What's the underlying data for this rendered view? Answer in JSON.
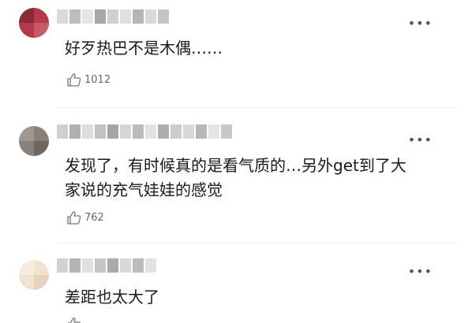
{
  "comments": [
    {
      "text": "好歹热巴不是木偶……",
      "likes": "1012",
      "more_label": "•••"
    },
    {
      "text": "发现了，有时候真的是看气质的…另外get到了大家说的充气娃娃的感觉",
      "likes": "762",
      "more_label": "•••"
    },
    {
      "text": "差距也太大了",
      "more_label": "•••"
    }
  ],
  "icons": {
    "like": "thumbs-up-icon",
    "more": "more-options-icon"
  },
  "colors": {
    "text": "#1a1a1a",
    "meta": "#666666",
    "divider": "#ececec"
  }
}
